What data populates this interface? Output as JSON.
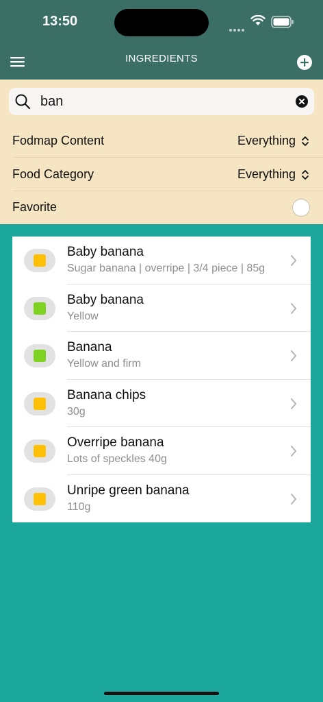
{
  "status": {
    "time": "13:50"
  },
  "header": {
    "title": "INGREDIENTS"
  },
  "search": {
    "value": "ban"
  },
  "filters": [
    {
      "label": "Fodmap Content",
      "value": "Everything"
    },
    {
      "label": "Food Category",
      "value": "Everything"
    },
    {
      "label": "Favorite",
      "toggle_on": false
    }
  ],
  "colors": {
    "header_bg": "#3b6f66",
    "filters_bg": "#f5e5c3",
    "page_bg": "#1ba79b",
    "fodmap_moderate": "#ffc107",
    "fodmap_low": "#7ed321"
  },
  "items": [
    {
      "name": "Baby banana",
      "description": "Sugar banana | overripe | 3/4 piece | 85g",
      "fodmap_color": "#ffc107"
    },
    {
      "name": "Baby banana",
      "description": "Yellow",
      "fodmap_color": "#7ed321"
    },
    {
      "name": "Banana",
      "description": "Yellow and firm",
      "fodmap_color": "#7ed321"
    },
    {
      "name": "Banana chips",
      "description": "30g",
      "fodmap_color": "#ffc107"
    },
    {
      "name": "Overripe banana",
      "description": "Lots of speckles 40g",
      "fodmap_color": "#ffc107"
    },
    {
      "name": "Unripe green banana",
      "description": "110g",
      "fodmap_color": "#ffc107"
    }
  ]
}
